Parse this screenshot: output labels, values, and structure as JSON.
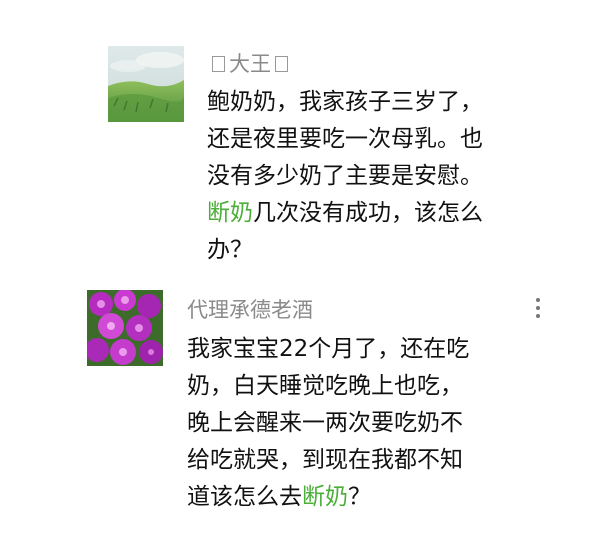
{
  "comments": [
    {
      "author": "大王",
      "avatar": "landscape-avatar",
      "lines": [
        {
          "pre": "鲍奶奶，我家孩子三岁了，",
          "hl": "",
          "post": ""
        },
        {
          "pre": "还是夜里要吃一次母乳。也",
          "hl": "",
          "post": ""
        },
        {
          "pre": "没有多少奶了主要是安慰。",
          "hl": "",
          "post": ""
        },
        {
          "pre": "",
          "hl": "断奶",
          "post": "几次没有成功，该怎么"
        },
        {
          "pre": "办？",
          "hl": "",
          "post": ""
        }
      ]
    },
    {
      "author": "代理承德老酒",
      "avatar": "purple-flowers-avatar",
      "lines": [
        {
          "pre": "我家宝宝22个月了，还在吃",
          "hl": "",
          "post": ""
        },
        {
          "pre": "奶，白天睡觉吃晚上也吃，",
          "hl": "",
          "post": ""
        },
        {
          "pre": "晚上会醒来一两次要吃奶不",
          "hl": "",
          "post": ""
        },
        {
          "pre": "给吃就哭，到现在我都不知",
          "hl": "",
          "post": ""
        },
        {
          "pre": "道该怎么去",
          "hl": "断奶",
          "post": "？"
        }
      ]
    }
  ],
  "colors": {
    "highlight": "#4caf3a",
    "name": "#8a8a8a",
    "text": "#111111"
  },
  "icons": {
    "more": "vertical-dots-icon"
  }
}
